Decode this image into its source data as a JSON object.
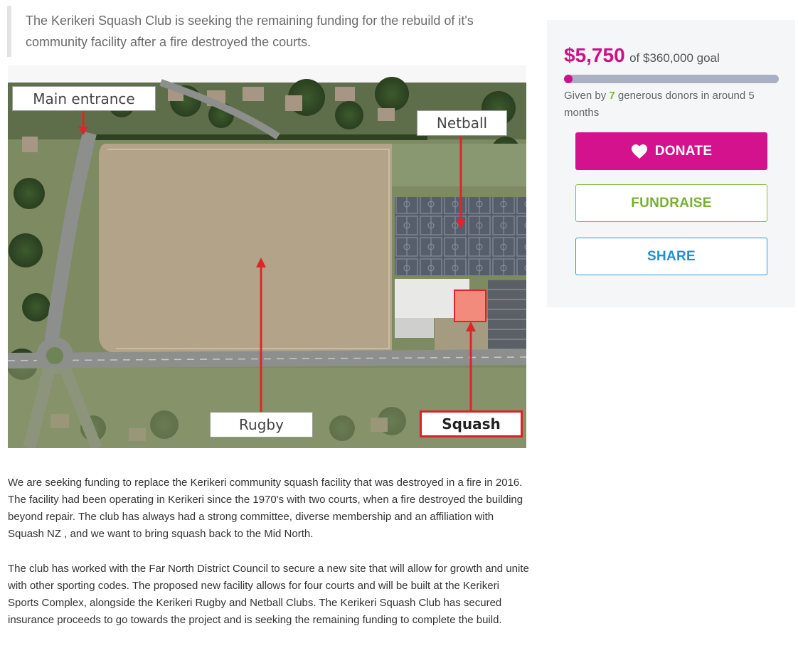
{
  "intro": {
    "text": "The Kerikeri Squash Club is seeking the remaining funding for the rebuild of it's community facility after a fire destroyed the courts."
  },
  "map": {
    "labels": {
      "main_entrance": "Main entrance",
      "netball": "Netball",
      "rugby": "Rugby",
      "squash": "Squash"
    },
    "colors": {
      "arrow": "#e0242b",
      "squash_marker": "#f28b7b",
      "field": "#b7a88e",
      "netball_courts": "#5a6270"
    }
  },
  "body": {
    "paragraph_1": "We are seeking funding to replace the Kerikeri community squash facility that was destroyed in a fire in 2016. The facility had been operating in Kerikeri since the 1970's with two courts, when a fire destroyed the building beyond repair. The club has always had a strong committee, diverse membership and an affiliation with Squash NZ , and we want to bring squash back to the Mid North.",
    "paragraph_2": "The club has worked with the Far North District Council to secure a new site that will allow for growth and unite with other sporting codes. The proposed new facility allows for four courts and will be built at the Kerikeri Sports Complex, alongside the Kerikeri Rugby and Netball Clubs. The Kerikeri Squash Club has secured insurance proceeds to go towards the project and is seeking the remaining funding to complete the build."
  },
  "donation": {
    "raised": "$5,750",
    "goal_text": "of $360,000 goal",
    "progress_fraction": 0.016,
    "donors_prefix": "Given by ",
    "donors_count": "7",
    "donors_suffix": " generous donors in around 5 months",
    "colors": {
      "brand_pink": "#d4128d",
      "fundraise_green": "#76b02d",
      "share_blue": "#1e8fd2"
    }
  },
  "buttons": {
    "donate": "DONATE",
    "fundraise": "FUNDRAISE",
    "share": "SHARE",
    "donate_icon": "heart-icon"
  }
}
